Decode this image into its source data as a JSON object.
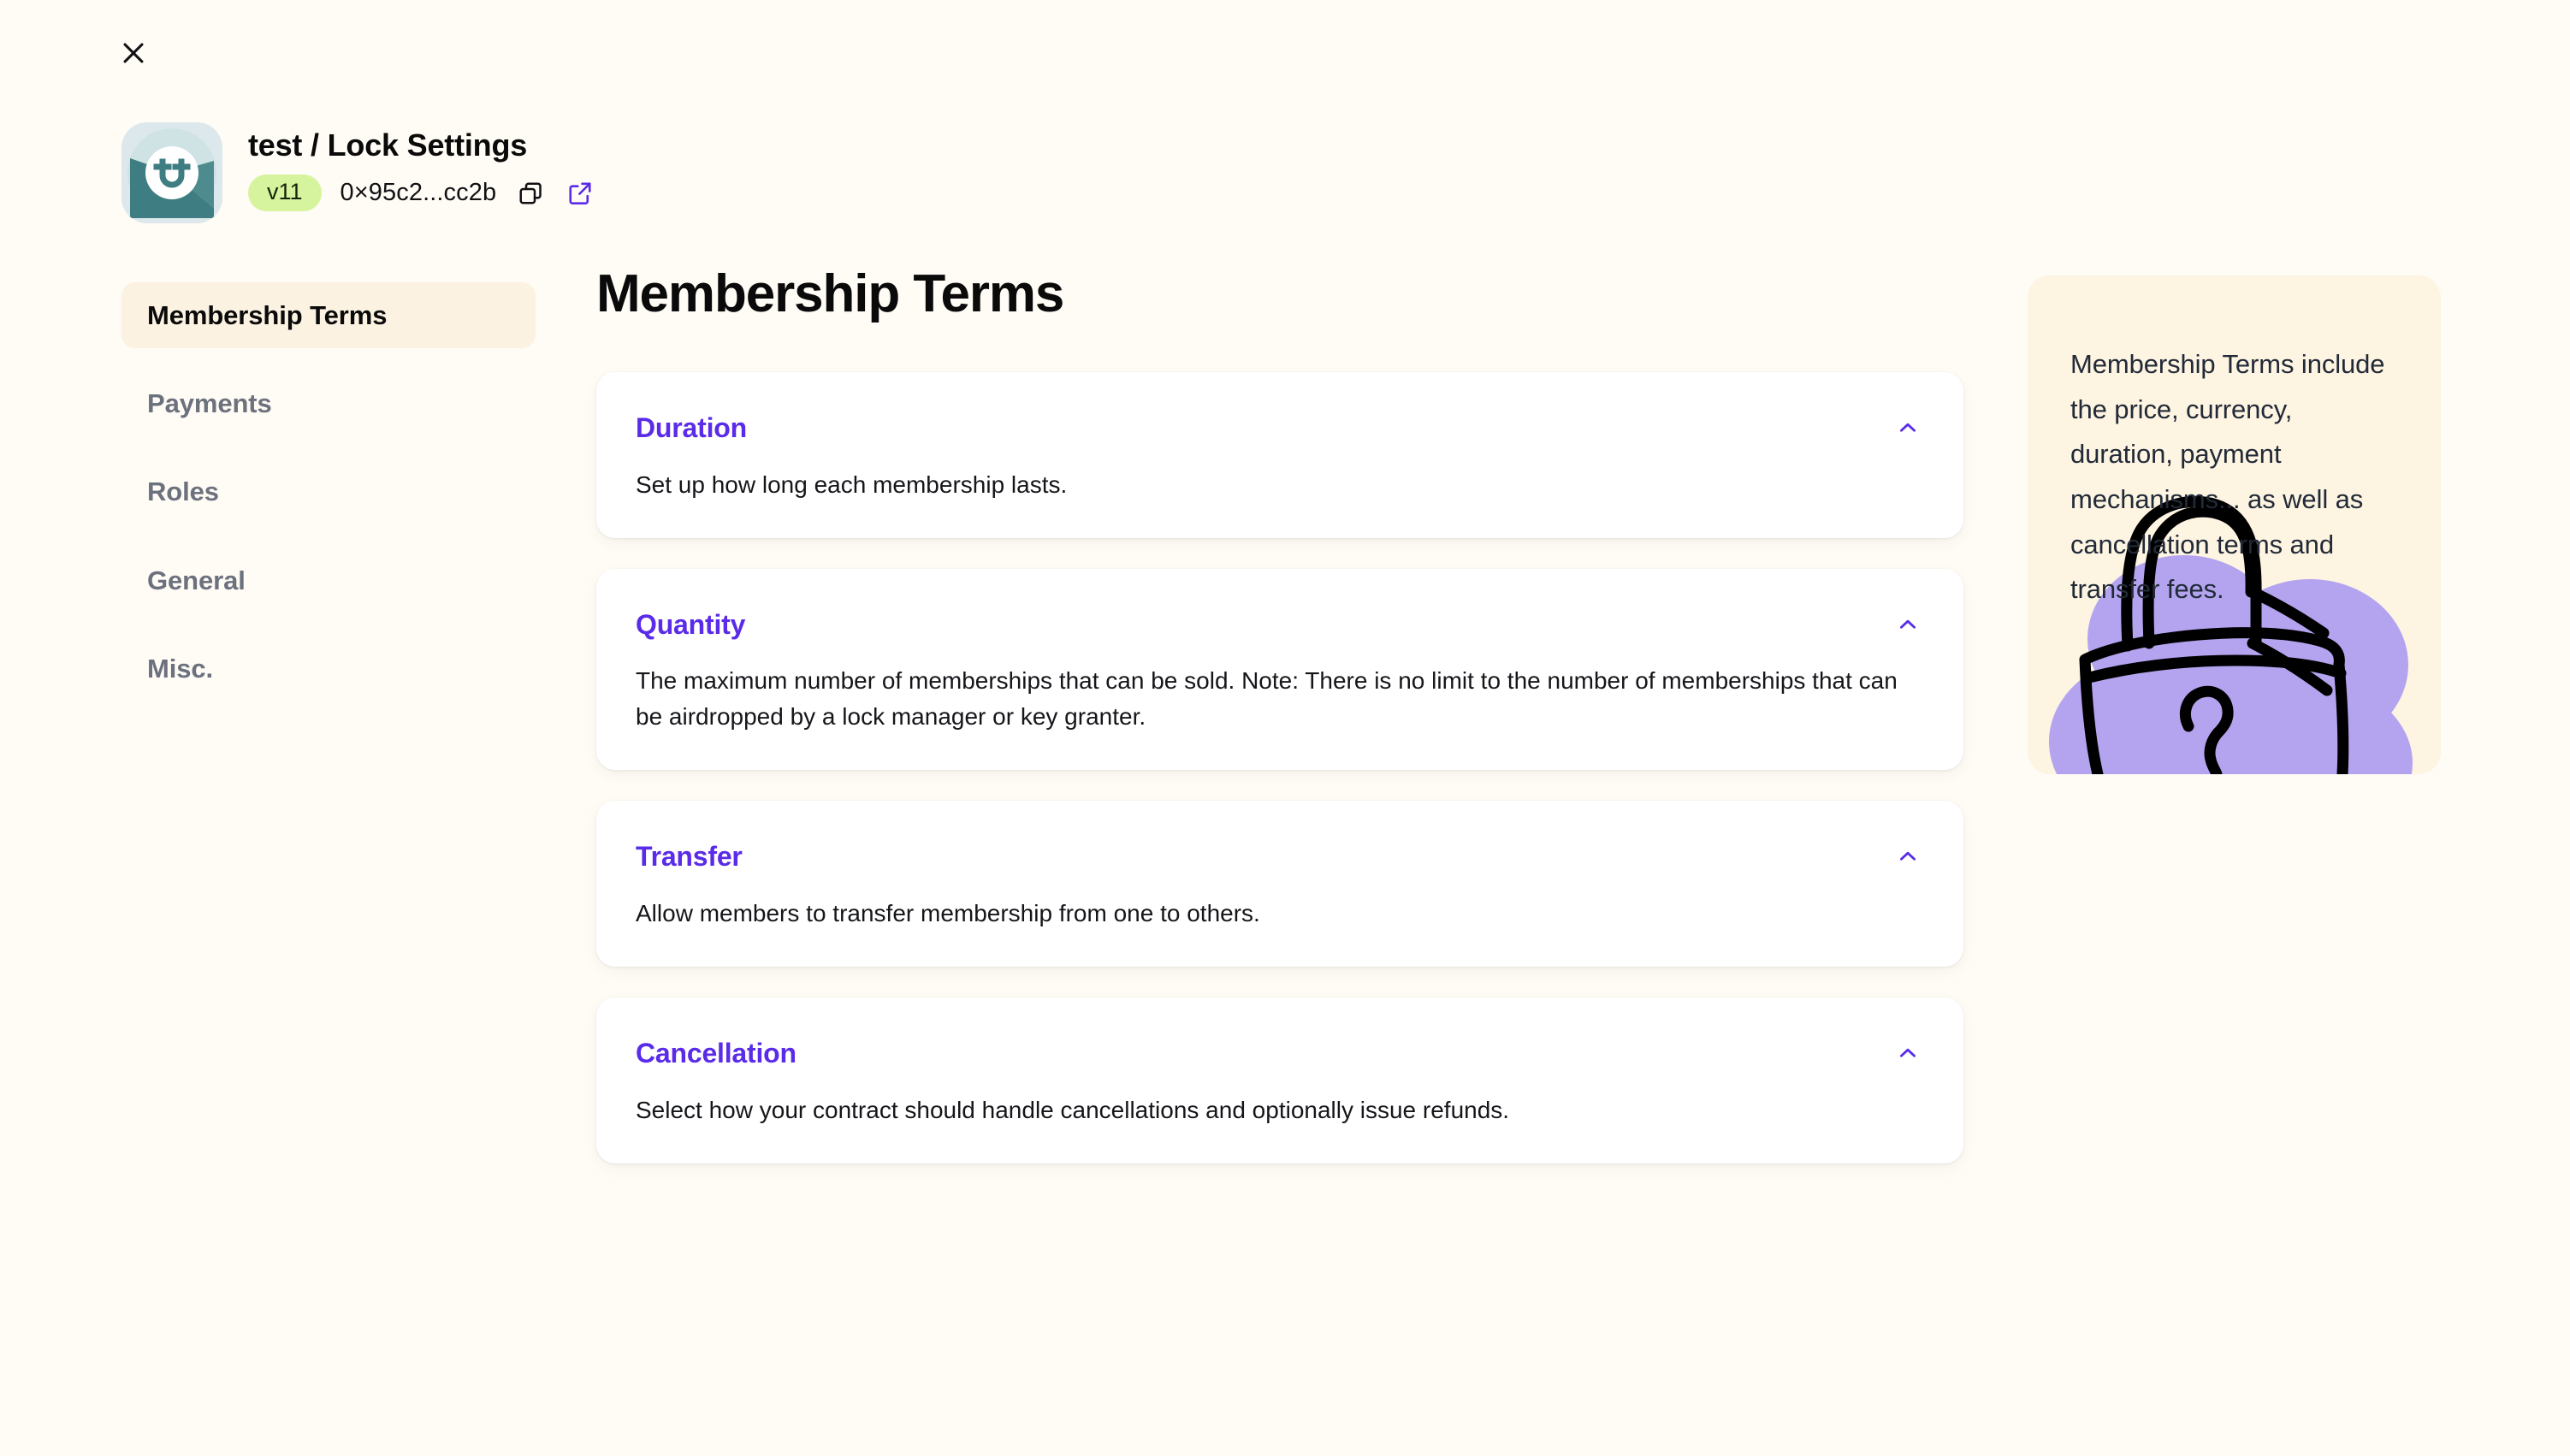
{
  "window": {
    "close_label": "Close",
    "close_icon": "close-icon"
  },
  "header": {
    "avatar_icon": "lock-avatar-icon",
    "lock_title": "test / Lock Settings",
    "version": "v11",
    "address": "0×95c2...cc2b",
    "copy_icon": "copy-icon",
    "external_link_icon": "external-link-icon",
    "accent_color": "#5A2BE8",
    "badge_color": "#D6F49D"
  },
  "sidebar": {
    "items": [
      {
        "label": "Membership Terms",
        "active": true
      },
      {
        "label": "Payments",
        "active": false
      },
      {
        "label": "Roles",
        "active": false
      },
      {
        "label": "General",
        "active": false
      },
      {
        "label": "Misc.",
        "active": false
      }
    ]
  },
  "main": {
    "page_title": "Membership Terms",
    "cards": [
      {
        "title": "Duration",
        "description": "Set up how long each membership lasts.",
        "toggle_icon": "chevron-up-icon"
      },
      {
        "title": "Quantity",
        "description": "The maximum number of memberships that can be sold. Note: There is no limit to the number of memberships that can be airdropped by a lock manager or key granter.",
        "toggle_icon": "chevron-up-icon"
      },
      {
        "title": "Transfer",
        "description": "Allow members to transfer membership from one to others.",
        "toggle_icon": "chevron-up-icon"
      },
      {
        "title": "Cancellation",
        "description": "Select how your contract should handle cancellations and optionally issue refunds.",
        "toggle_icon": "chevron-up-icon"
      }
    ]
  },
  "info_panel": {
    "text": "Membership Terms include the price, currency, duration, payment mechanisms... as well as cancellation terms and transfer fees.",
    "illustration_icon": "padlock-illustration",
    "background_color": "#FDF4E2",
    "blob_color": "#B4A4F0"
  }
}
